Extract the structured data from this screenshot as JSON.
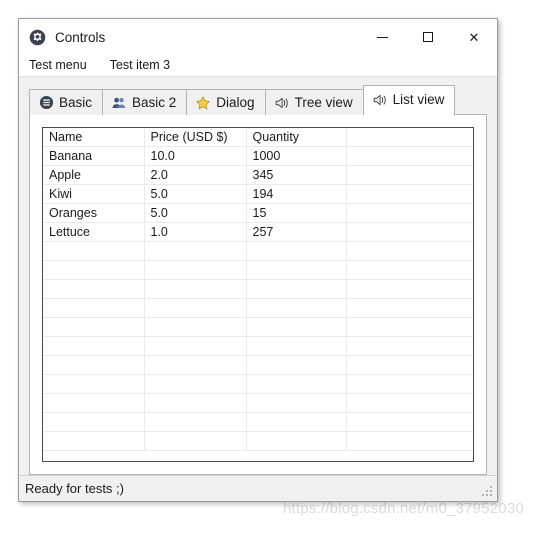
{
  "window": {
    "title": "Controls",
    "title_icon": "gear-icon",
    "controls": {
      "minimize": "—",
      "maximize": "□",
      "close": "✕"
    }
  },
  "menubar": {
    "items": [
      {
        "label": "Test menu"
      },
      {
        "label": "Test item 3"
      }
    ]
  },
  "tabs": [
    {
      "label": "Basic",
      "icon": "circle-list-icon",
      "selected": false
    },
    {
      "label": "Basic 2",
      "icon": "users-icon",
      "selected": false
    },
    {
      "label": "Dialog",
      "icon": "star-icon",
      "selected": false
    },
    {
      "label": "Tree view",
      "icon": "speaker-icon",
      "selected": false
    },
    {
      "label": "List view",
      "icon": "speaker-icon",
      "selected": true
    }
  ],
  "list_view": {
    "columns": [
      "Name",
      "Price (USD $)",
      "Quantity",
      ""
    ],
    "rows": [
      [
        "Banana",
        "10.0",
        "1000",
        ""
      ],
      [
        "Apple",
        "2.0",
        "345",
        ""
      ],
      [
        "Kiwi",
        "5.0",
        "194",
        ""
      ],
      [
        "Oranges",
        "5.0",
        "15",
        ""
      ],
      [
        "Lettuce",
        "1.0",
        "257",
        ""
      ]
    ],
    "empty_row_count": 11
  },
  "statusbar": {
    "text": "Ready for tests ;)"
  },
  "watermark": {
    "text": "https://blog.csdn.net/m0_37952030"
  },
  "colors": {
    "window_bg": "#f0f0f0",
    "titlebar_bg": "#ffffff",
    "tab_border": "#b4b4b4",
    "table_border": "#4a4a4a",
    "grid_line": "#eaeaea",
    "star_gold": "#f4c63d",
    "users_blue": "#4a6a9e",
    "text": "#1b1b1b"
  }
}
